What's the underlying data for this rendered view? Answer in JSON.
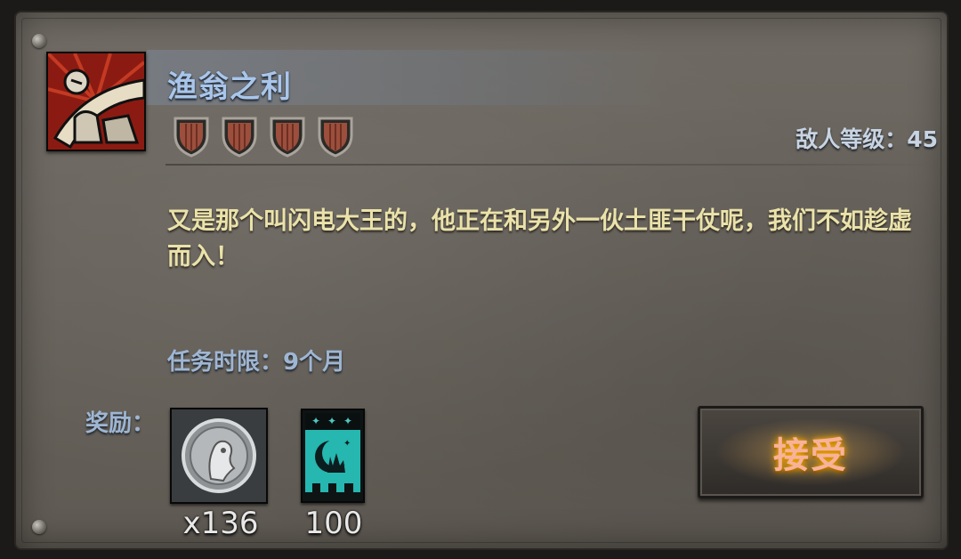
{
  "quest": {
    "title": "渔翁之利",
    "difficulty": 4,
    "enemy_level_text": "敌人等级：45",
    "description": "又是那个叫闪电大王的，他正在和另外一伙土匪干仗呢，我们不如趁虚而入！",
    "time_limit_text": "任务时限：9个月"
  },
  "rewards": {
    "label": "奖励：",
    "items": [
      {
        "icon": "silver-coin-icon",
        "count": "x136"
      },
      {
        "icon": "crescent-banner-icon",
        "count": "100"
      }
    ]
  },
  "actions": {
    "accept_label": "接受"
  },
  "colors": {
    "title": "#a9c6ea",
    "description": "#ebe2aa",
    "accept_glow": "#ffb800"
  }
}
